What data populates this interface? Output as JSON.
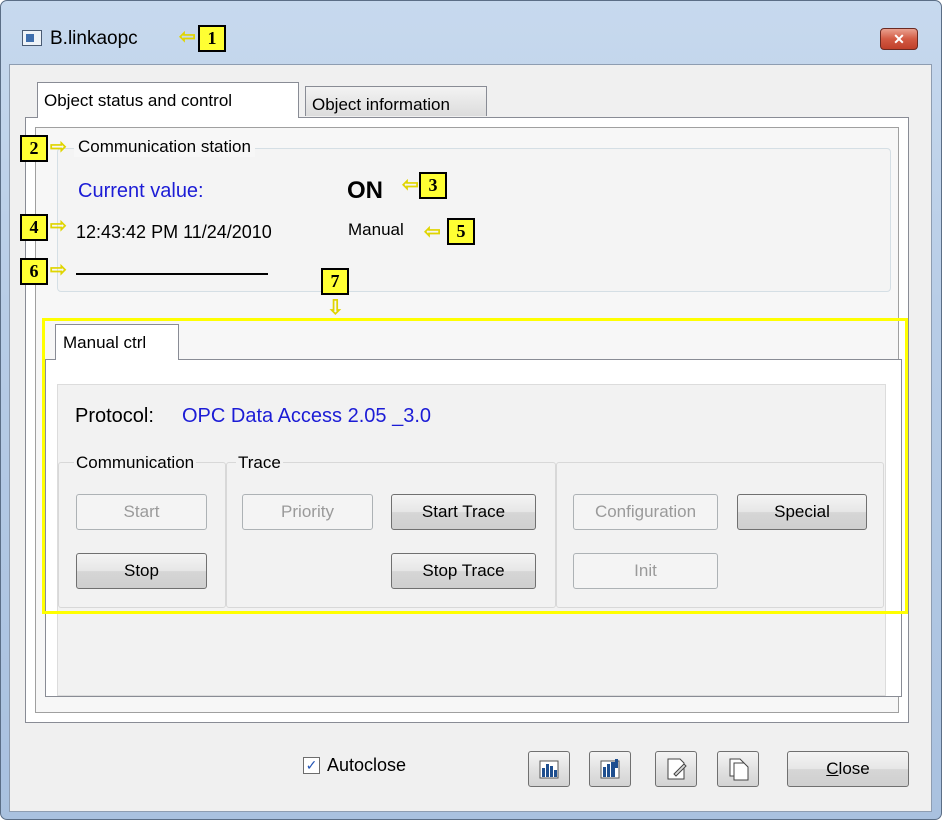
{
  "window": {
    "title": "B.linkaopc",
    "close_glyph": "✕"
  },
  "tabs": {
    "status": "Object status and control",
    "info": "Object information"
  },
  "comm_station": {
    "title": "Communication station",
    "current_value_label": "Current value:",
    "current_value": "ON",
    "timestamp": "12:43:42 PM 11/24/2010",
    "mode": "Manual"
  },
  "manual": {
    "tab": "Manual ctrl",
    "protocol_label": "Protocol:",
    "protocol_value": "OPC Data Access 2.05 _3.0",
    "group_communication": "Communication",
    "group_trace": "Trace",
    "buttons": {
      "start": "Start",
      "stop": "Stop",
      "priority": "Priority",
      "start_trace": "Start Trace",
      "stop_trace": "Stop Trace",
      "configuration": "Configuration",
      "init": "Init",
      "special": "Special"
    }
  },
  "footer": {
    "autoclose_label": "Autoclose",
    "autoclose_checked": true,
    "close_label_rest": "lose",
    "close_label_underline": "C"
  },
  "annotations": [
    "1",
    "2",
    "3",
    "4",
    "5",
    "6",
    "7"
  ],
  "colors": {
    "highlight": "#ffff00",
    "link_blue": "#1c1cd6"
  }
}
